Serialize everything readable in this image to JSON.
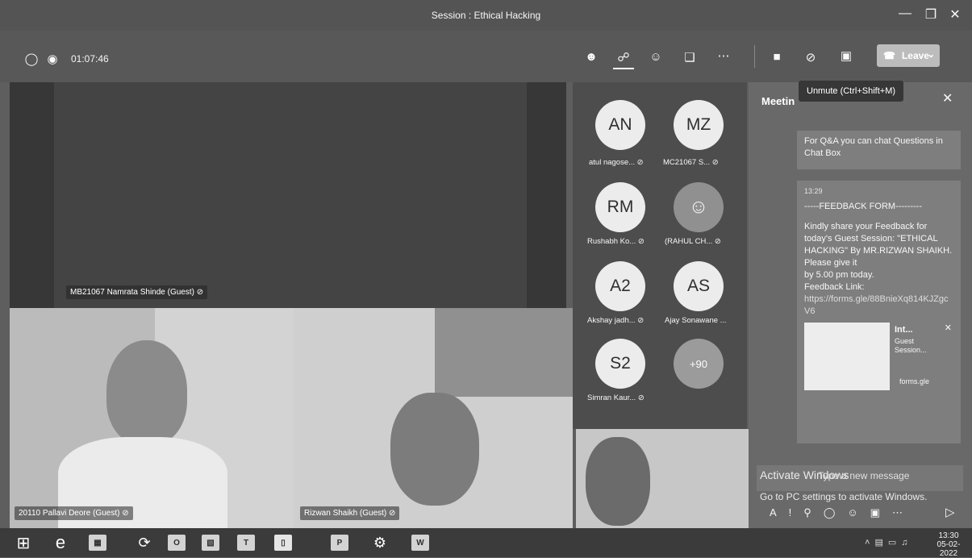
{
  "window": {
    "title": "Session : Ethical Hacking"
  },
  "toolbar": {
    "timer": "01:07:46",
    "leave_label": "Leave",
    "tooltip": "Unmute (Ctrl+Shift+M)"
  },
  "videos": {
    "main_name": "MB21067 Namrata Shinde (Guest)",
    "left_name": "20110 Pallavi Deore (Guest)",
    "center_name": "Rizwan Shaikh (Guest)"
  },
  "participants": [
    {
      "initials": "AN",
      "name": "atul nagose..."
    },
    {
      "initials": "MZ",
      "name": "MC21067 S..."
    },
    {
      "initials": "RM",
      "name": "Rushabh Ko..."
    },
    {
      "initials": "",
      "name": "(RAHUL CH..."
    },
    {
      "initials": "A2",
      "name": "Akshay jadh..."
    },
    {
      "initials": "AS",
      "name": "Ajay Sonawane ..."
    },
    {
      "initials": "S2",
      "name": "Simran Kaur..."
    },
    {
      "initials": "+90",
      "name": ""
    }
  ],
  "chat": {
    "header": "Meetin",
    "msg1": "For Q&A you can chat Questions in Chat Box",
    "msg2_time": "13:29",
    "msg2_title": "-----FEEDBACK FORM---------",
    "msg2_body": "Kindly share your Feedback for today's Guest Session: \"ETHICAL HACKING\" By MR.RIZWAN SHAIKH. Please give it",
    "msg2_deadline": "by 5.00 pm today.",
    "msg2_link_label": "Feedback Link:",
    "msg2_link": "https://forms.gle/88BnieXq814KJZgcV6",
    "card_title": "Int...",
    "card_sub": "Guest Session...",
    "card_domain": "forms.gle",
    "input_placeholder": "Type a new message",
    "activate_line1": "Activate Windows",
    "activate_line2": "Go to PC settings to activate Windows."
  },
  "taskbar": {
    "time": "13:30",
    "date": "05-02-2022"
  }
}
